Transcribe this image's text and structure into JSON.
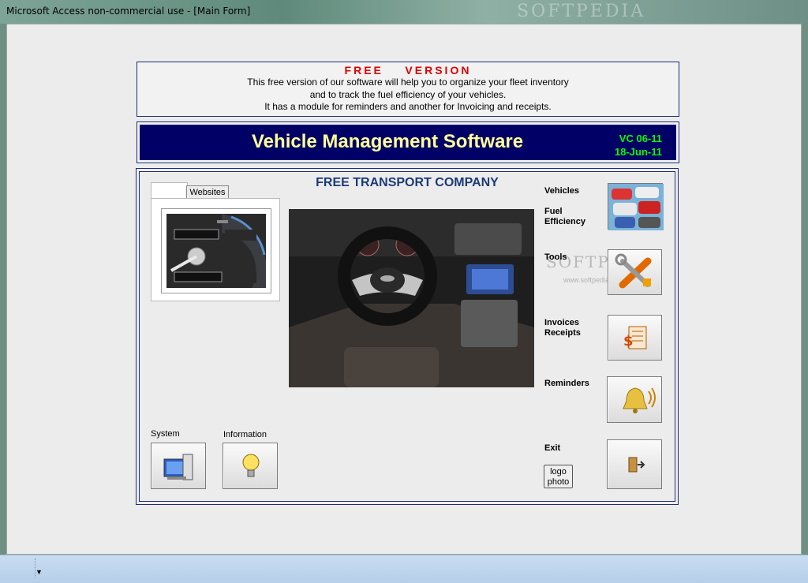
{
  "window": {
    "title": "Microsoft Access non-commercial use - [Main Form]",
    "watermark": "SOFTPEDIA"
  },
  "free_panel": {
    "heading": "FREE    VERSION",
    "lines": [
      "This free version of our software will help you to organize your fleet inventory",
      "and to track the fuel efficiency of your vehicles.",
      "It has a module for reminders and another for Invoicing and receipts."
    ]
  },
  "banner": {
    "title": "Vehicle Management Software",
    "version": "VC 06-11",
    "date": "18-Jun-11"
  },
  "company": "FREE TRANSPORT COMPANY",
  "tabs": {
    "active": "",
    "websites": "Websites"
  },
  "menu": {
    "vehicles": "Vehicles",
    "fuel_line1": "Fuel",
    "fuel_line2": "Efficiency",
    "tools": "Tools",
    "invoices_line1": "Invoices",
    "invoices_line2": "Receipts",
    "reminders": "Reminders",
    "exit": "Exit",
    "system": "System",
    "information": "Information"
  },
  "logo_button": {
    "line1": "logo",
    "line2": "photo"
  },
  "watermark_overlay": {
    "main": "SOFTPE",
    "sub": "www.softpedia.com"
  },
  "colors": {
    "banner_bg": "#000066",
    "banner_title": "#ffff99",
    "banner_version": "#00ff00",
    "free_heading": "#e00000",
    "company": "#1c3a78"
  },
  "icons": [
    "cars-icon",
    "tools-icon",
    "invoice-icon",
    "bell-icon",
    "exit-door-icon",
    "computer-icon",
    "lightbulb-icon",
    "dropdown-arrow-icon"
  ]
}
